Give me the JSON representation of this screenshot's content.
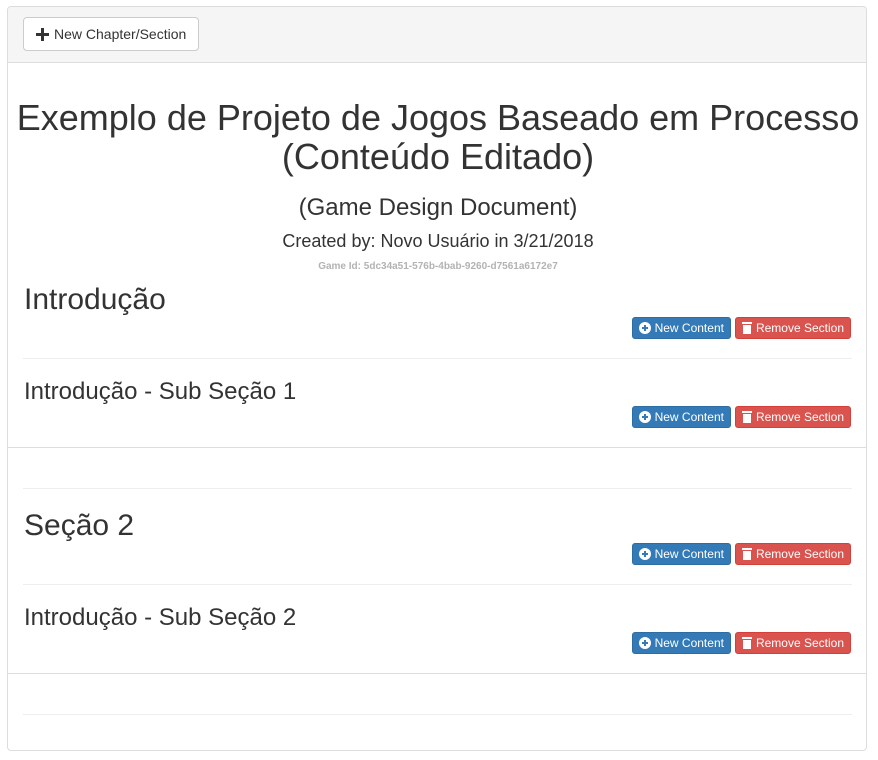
{
  "toolbar": {
    "new_chapter_label": "New Chapter/Section",
    "new_chapter_icon": "plus-icon"
  },
  "document": {
    "title_line1": "Exemplo de Projeto de Jogos Baseado em Processo",
    "title_line2": "(Conteúdo Editado)",
    "subtitle": "(Game Design Document)",
    "created_by": "Created by: Novo Usuário in 3/21/2018",
    "game_id": "Game Id: 5dc34a51-576b-4bab-9260-d7561a6172e7"
  },
  "buttons": {
    "new_content": "New Content",
    "remove_section": "Remove Section",
    "new_content_icon": "plus-circle-icon",
    "remove_icon": "trash-icon"
  },
  "sections": [
    {
      "title": "Introdução",
      "subsections": [
        {
          "title": "Introdução - Sub Seção 1"
        }
      ]
    },
    {
      "title": "Seção 2",
      "subsections": [
        {
          "title": "Introdução - Sub Seção 2"
        }
      ]
    }
  ],
  "colors": {
    "primary": "#337ab7",
    "danger": "#d9534f",
    "heading_bg": "#f5f5f5"
  }
}
